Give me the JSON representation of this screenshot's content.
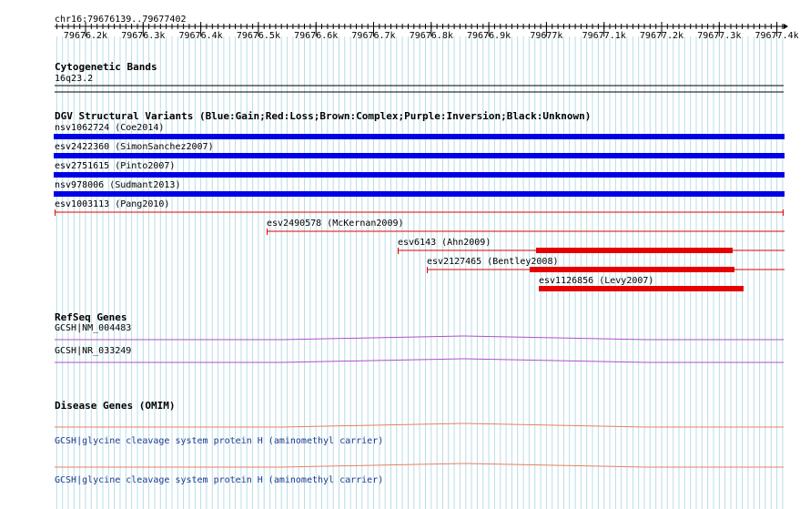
{
  "ruler": {
    "region": "chr16:79676139..79677402",
    "ticks": [
      "79676.2k",
      "79676.3k",
      "79676.4k",
      "79676.5k",
      "79676.6k",
      "79676.7k",
      "79676.8k",
      "79676.9k",
      "79677k",
      "79677.1k",
      "79677.2k",
      "79677.3k",
      "79677.4k"
    ]
  },
  "tracks": {
    "cytoband": {
      "title": "Cytogenetic Bands",
      "label": "16q23.2"
    },
    "dgv": {
      "title": "DGV Structural Variants (Blue:Gain;Red:Loss;Brown:Complex;Purple:Inversion;Black:Unknown)",
      "features": [
        {
          "label": "nsv1062724 (Coe2014)",
          "type": "gain"
        },
        {
          "label": "esv2422360 (SimonSanchez2007)",
          "type": "gain"
        },
        {
          "label": "esv2751615 (Pinto2007)",
          "type": "gain"
        },
        {
          "label": "nsv978006 (Sudmant2013)",
          "type": "gain"
        },
        {
          "label": "esv1003113 (Pang2010)",
          "type": "loss"
        },
        {
          "label": "esv2490578 (McKernan2009)",
          "type": "loss"
        },
        {
          "label": "esv6143 (Ahn2009)",
          "type": "loss"
        },
        {
          "label": "esv2127465 (Bentley2008)",
          "type": "loss"
        },
        {
          "label": "esv1126856 (Levy2007)",
          "type": "loss"
        }
      ]
    },
    "refseq": {
      "title": "RefSeq Genes",
      "genes": [
        {
          "label": "GCSH|NM_004483"
        },
        {
          "label": "GCSH|NR_033249"
        }
      ]
    },
    "omim": {
      "title": "Disease Genes (OMIM)",
      "genes": [
        {
          "label": "GCSH|glycine cleavage system protein H (aminomethyl carrier)"
        },
        {
          "label": "GCSH|glycine cleavage system protein H (aminomethyl carrier)"
        }
      ]
    }
  },
  "colors": {
    "grid": "#b8dce8",
    "gain": "#0000e6",
    "loss": "#e60000",
    "refseq": "#b050c8",
    "omim": "#e88060",
    "link": "#1d3c8c"
  }
}
